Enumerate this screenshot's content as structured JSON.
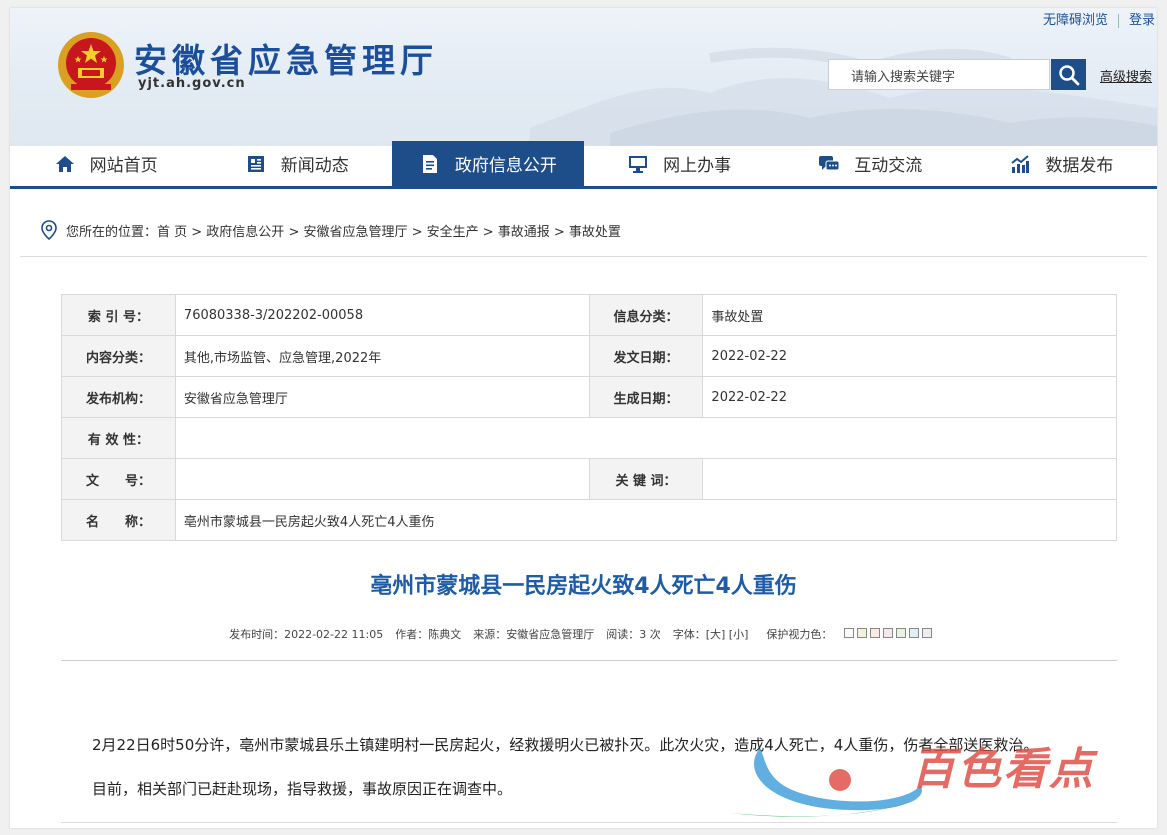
{
  "header": {
    "site_title": "安徽省应急管理厅",
    "site_domain": "yjt.ah.gov.cn",
    "top_links": [
      "无障碍浏览",
      "登录"
    ],
    "search_placeholder": "请输入搜索关键字",
    "advanced_search": "高级搜索",
    "brand_color": "#1d4e89"
  },
  "nav": {
    "items": [
      {
        "label": "网站首页",
        "icon": "home-icon"
      },
      {
        "label": "新闻动态",
        "icon": "news-icon"
      },
      {
        "label": "政府信息公开",
        "icon": "document-icon",
        "active": true
      },
      {
        "label": "网上办事",
        "icon": "monitor-icon"
      },
      {
        "label": "互动交流",
        "icon": "chat-icon"
      },
      {
        "label": "数据发布",
        "icon": "chart-icon"
      }
    ]
  },
  "breadcrumb": {
    "prefix": "您所在的位置：",
    "path": "首 页 > 政府信息公开 > 安徽省应急管理厅 > 安全生产 > 事故通报 > 事故处置"
  },
  "info": {
    "index_label": "索 引 号：",
    "index_value": "76080338-3/202202-00058",
    "category_label": "信息分类：",
    "category_value": "事故处置",
    "content_label": "内容分类：",
    "content_value": "其他,市场监管、应急管理,2022年",
    "issue_date_label": "发文日期：",
    "issue_date_value": "2022-02-22",
    "publisher_label": "发布机构：",
    "publisher_value": "安徽省应急管理厅",
    "gen_date_label": "生成日期：",
    "gen_date_value": "2022-02-22",
    "validity_label": "有 效 性：",
    "validity_value": "",
    "doc_no_label": "文　　号：",
    "doc_no_value": "",
    "keywords_label": "关 键 词：",
    "keywords_value": "",
    "name_label": "名　　称：",
    "name_value": "亳州市蒙城县一民房起火致4人死亡4人重伤"
  },
  "article": {
    "title": "亳州市蒙城县一民房起火致4人死亡4人重伤",
    "publish_time": "发布时间：2022-02-22 11:05",
    "author": "作者：陈典文",
    "source": "来源：安徽省应急管理厅",
    "reads": "阅读：3 次",
    "font_size": "字体：[大] [小]",
    "eye_color": "保护视力色：",
    "paragraph1": "2月22日6时50分许，亳州市蒙城县乐土镇建明村一民房起火，经救援明火已被扑灭。此次火灾，造成4人死亡，4人重伤，伤者全部送医救治。",
    "paragraph2": "目前，相关部门已赶赴现场，指导救援，事故原因正在调查中。"
  },
  "watermark": {
    "text": "百色看点"
  }
}
